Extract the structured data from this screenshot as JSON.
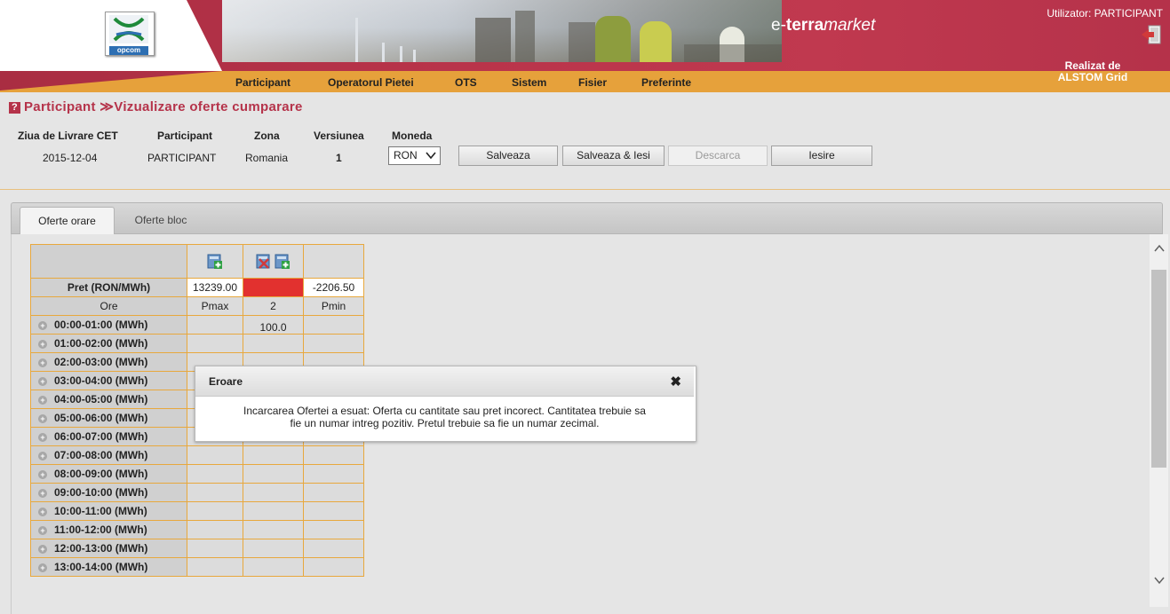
{
  "header": {
    "logo_text": "opcom",
    "brand": {
      "prefix": "e-",
      "strong": "terra",
      "rest": "market"
    },
    "user": "Utilizator: PARTICIPANT",
    "realizat_line1": "Realizat de",
    "realizat_line2": "ALSTOM Grid",
    "menu": [
      "Participant",
      "Operatorul Pietei",
      "OTS",
      "Sistem",
      "Fisier",
      "Preferinte"
    ]
  },
  "page": {
    "title": "Participant ≫Vizualizare oferte cumparare",
    "help_glyph": "?"
  },
  "params": {
    "labels": {
      "ziua": "Ziua de Livrare CET",
      "participant": "Participant",
      "zona": "Zona",
      "versiunea": "Versiunea",
      "moneda": "Moneda"
    },
    "values": {
      "ziua": "2015-12-04",
      "participant": "PARTICIPANT",
      "zona": "Romania",
      "versiunea": "1",
      "moneda": "RON"
    }
  },
  "buttons": {
    "salveaza": "Salveaza",
    "salveaza_iesi": "Salveaza & Iesi",
    "descarca": "Descarca",
    "iesire": "Iesire"
  },
  "tabs": {
    "orare": "Oferte orare",
    "bloc": "Oferte bloc"
  },
  "grid": {
    "pret_label": "Pret (RON/MWh)",
    "pret_values": [
      "13239.00",
      "",
      "-2206.50"
    ],
    "ore_label": "Ore",
    "col_headers": [
      "Pmax",
      "2",
      "Pmin"
    ],
    "rows": [
      {
        "label": "00:00-01:00 (MWh)",
        "v": [
          "",
          "100.0",
          ""
        ]
      },
      {
        "label": "01:00-02:00 (MWh)",
        "v": [
          "",
          "",
          ""
        ]
      },
      {
        "label": "02:00-03:00 (MWh)",
        "v": [
          "",
          "",
          ""
        ]
      },
      {
        "label": "03:00-04:00 (MWh)",
        "v": [
          "",
          "",
          ""
        ]
      },
      {
        "label": "04:00-05:00 (MWh)",
        "v": [
          "",
          "",
          ""
        ]
      },
      {
        "label": "05:00-06:00 (MWh)",
        "v": [
          "",
          "",
          ""
        ]
      },
      {
        "label": "06:00-07:00 (MWh)",
        "v": [
          "",
          "",
          ""
        ]
      },
      {
        "label": "07:00-08:00 (MWh)",
        "v": [
          "",
          "",
          ""
        ]
      },
      {
        "label": "08:00-09:00 (MWh)",
        "v": [
          "",
          "",
          ""
        ]
      },
      {
        "label": "09:00-10:00 (MWh)",
        "v": [
          "",
          "",
          ""
        ]
      },
      {
        "label": "10:00-11:00 (MWh)",
        "v": [
          "",
          "",
          ""
        ]
      },
      {
        "label": "11:00-12:00 (MWh)",
        "v": [
          "",
          "",
          ""
        ]
      },
      {
        "label": "12:00-13:00 (MWh)",
        "v": [
          "",
          "",
          ""
        ]
      },
      {
        "label": "13:00-14:00 (MWh)",
        "v": [
          "",
          "",
          ""
        ]
      }
    ]
  },
  "dialog": {
    "title": "Eroare",
    "close_glyph": "✖",
    "message_line1": "Incarcarea Ofertei a esuat: Oferta cu cantitate sau pret incorect. Cantitatea trebuie sa",
    "message_line2": "fie un numar intreg pozitiv. Pretul trebuie sa fie un numar zecimal."
  },
  "colors": {
    "brand_red": "#b5334a",
    "menu_orange": "#e6a13b",
    "grid_border": "#e8a83d",
    "error_cell": "#e2312f"
  }
}
